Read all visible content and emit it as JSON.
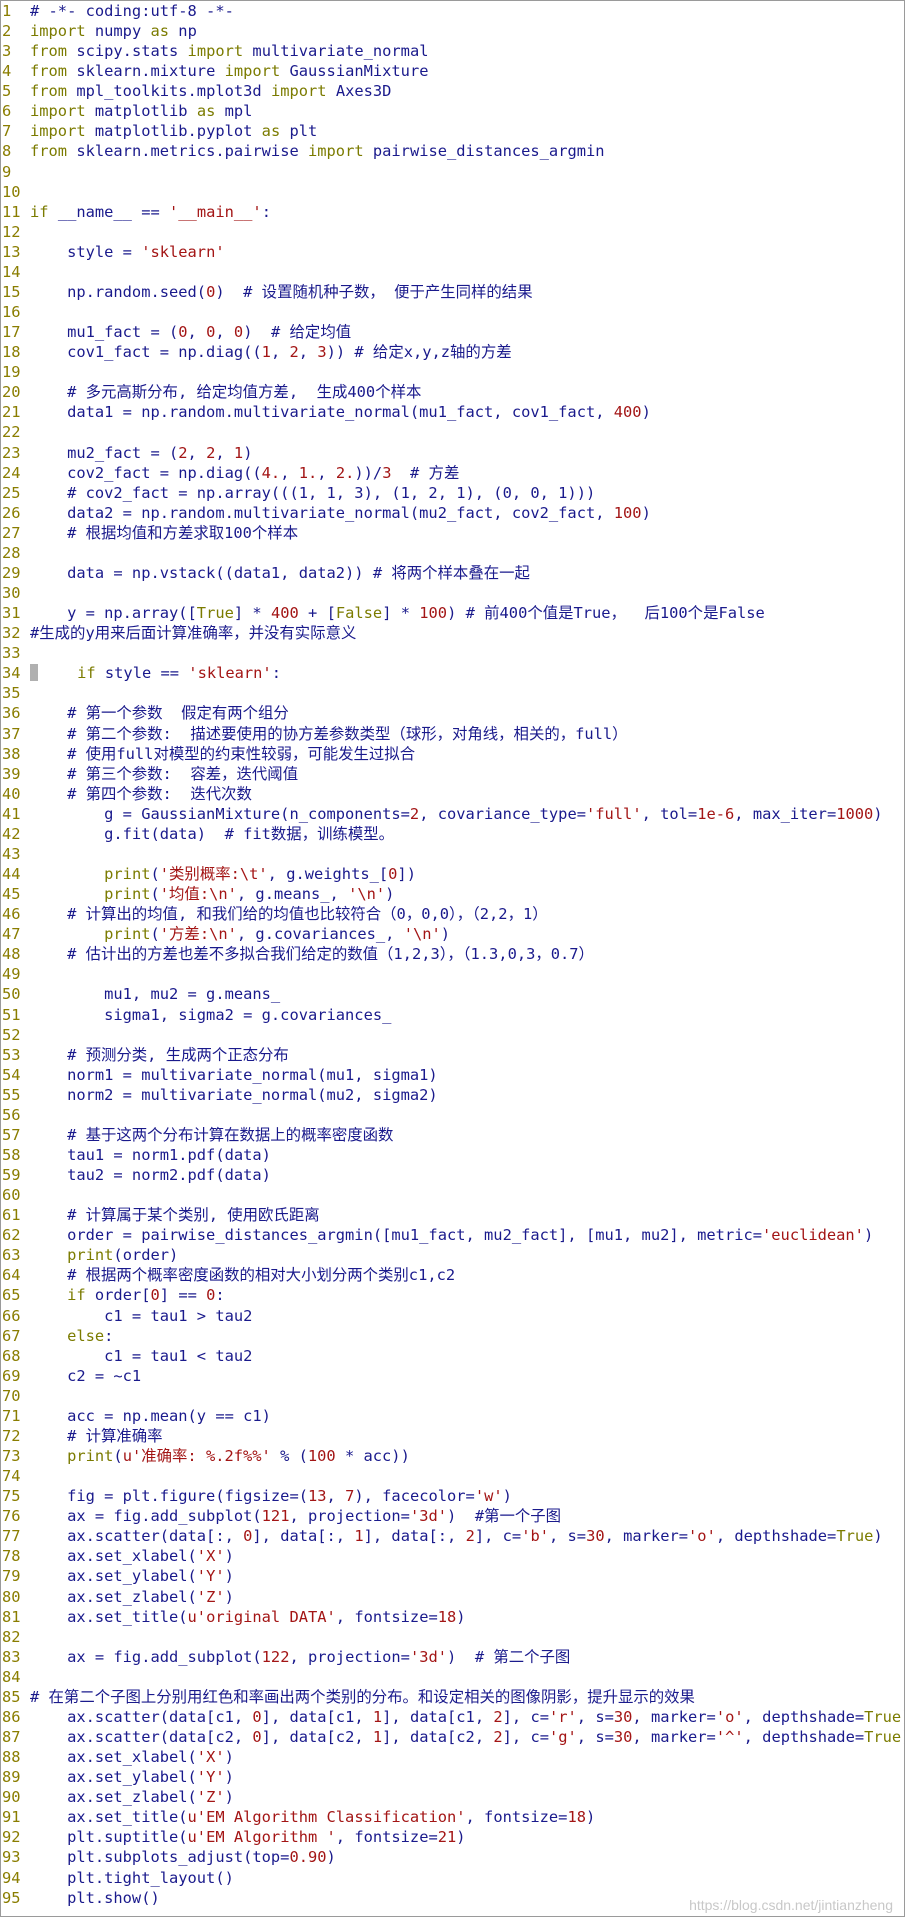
{
  "colors": {
    "keyword": "#7b7b00",
    "string": "#a31515",
    "text": "#1a1a8c",
    "line_number": "#8a7d00"
  },
  "watermark": "https://blog.csdn.net/jintianzheng",
  "lines": [
    [
      [
        "c",
        "# -*- coding:utf-8 -*-"
      ]
    ],
    [
      [
        "kw",
        "import"
      ],
      [
        "t",
        " numpy "
      ],
      [
        "kw",
        "as"
      ],
      [
        "t",
        " np"
      ]
    ],
    [
      [
        "kw",
        "from"
      ],
      [
        "t",
        " scipy.stats "
      ],
      [
        "kw",
        "import"
      ],
      [
        "t",
        " multivariate_normal"
      ]
    ],
    [
      [
        "kw",
        "from"
      ],
      [
        "t",
        " sklearn.mixture "
      ],
      [
        "kw",
        "import"
      ],
      [
        "t",
        " GaussianMixture"
      ]
    ],
    [
      [
        "kw",
        "from"
      ],
      [
        "t",
        " mpl_toolkits.mplot3d "
      ],
      [
        "kw",
        "import"
      ],
      [
        "t",
        " Axes3D"
      ]
    ],
    [
      [
        "kw",
        "import"
      ],
      [
        "t",
        " matplotlib "
      ],
      [
        "kw",
        "as"
      ],
      [
        "t",
        " mpl"
      ]
    ],
    [
      [
        "kw",
        "import"
      ],
      [
        "t",
        " matplotlib.pyplot "
      ],
      [
        "kw",
        "as"
      ],
      [
        "t",
        " plt"
      ]
    ],
    [
      [
        "kw",
        "from"
      ],
      [
        "t",
        " sklearn.metrics.pairwise "
      ],
      [
        "kw",
        "import"
      ],
      [
        "t",
        " pairwise_distances_argmin"
      ]
    ],
    [],
    [],
    [
      [
        "kw",
        "if"
      ],
      [
        "t",
        " __name__ == "
      ],
      [
        "s",
        "'__main__'"
      ],
      [
        "t",
        ":"
      ]
    ],
    [],
    [
      [
        "t",
        "    style = "
      ],
      [
        "s",
        "'sklearn'"
      ]
    ],
    [],
    [
      [
        "t",
        "    np.random.seed("
      ],
      [
        "n",
        "0"
      ],
      [
        "t",
        ")  # 设置随机种子数， 便于产生同样的结果"
      ]
    ],
    [],
    [
      [
        "t",
        "    mu1_fact = ("
      ],
      [
        "n",
        "0"
      ],
      [
        "t",
        ", "
      ],
      [
        "n",
        "0"
      ],
      [
        "t",
        ", "
      ],
      [
        "n",
        "0"
      ],
      [
        "t",
        ")  # 给定均值"
      ]
    ],
    [
      [
        "t",
        "    cov1_fact = np.diag(("
      ],
      [
        "n",
        "1"
      ],
      [
        "t",
        ", "
      ],
      [
        "n",
        "2"
      ],
      [
        "t",
        ", "
      ],
      [
        "n",
        "3"
      ],
      [
        "t",
        ")) # 给定x,y,z轴的方差"
      ]
    ],
    [],
    [
      [
        "t",
        "    # 多元高斯分布, 给定均值方差,  生成400个样本"
      ]
    ],
    [
      [
        "t",
        "    data1 = np.random.multivariate_normal(mu1_fact, cov1_fact, "
      ],
      [
        "n",
        "400"
      ],
      [
        "t",
        ")"
      ]
    ],
    [],
    [
      [
        "t",
        "    mu2_fact = ("
      ],
      [
        "n",
        "2"
      ],
      [
        "t",
        ", "
      ],
      [
        "n",
        "2"
      ],
      [
        "t",
        ", "
      ],
      [
        "n",
        "1"
      ],
      [
        "t",
        ")"
      ]
    ],
    [
      [
        "t",
        "    cov2_fact = np.diag(("
      ],
      [
        "n",
        "4."
      ],
      [
        "t",
        ", "
      ],
      [
        "n",
        "1."
      ],
      [
        "t",
        ", "
      ],
      [
        "n",
        "2."
      ],
      [
        "t",
        "))/"
      ],
      [
        "n",
        "3"
      ],
      [
        "t",
        "  # 方差"
      ]
    ],
    [
      [
        "t",
        "    # cov2_fact = np.array(((1, 1, 3), (1, 2, 1), (0, 0, 1)))"
      ]
    ],
    [
      [
        "t",
        "    data2 = np.random.multivariate_normal(mu2_fact, cov2_fact, "
      ],
      [
        "n",
        "100"
      ],
      [
        "t",
        ")"
      ]
    ],
    [
      [
        "t",
        "    # 根据均值和方差求取100个样本"
      ]
    ],
    [],
    [
      [
        "t",
        "    data = np.vstack((data1, data2)) # 将两个样本叠在一起"
      ]
    ],
    [],
    [
      [
        "t",
        "    y = np.array(["
      ],
      [
        "kw",
        "True"
      ],
      [
        "t",
        "] * "
      ],
      [
        "n",
        "400"
      ],
      [
        "t",
        " + ["
      ],
      [
        "kw",
        "False"
      ],
      [
        "t",
        "] * "
      ],
      [
        "n",
        "100"
      ],
      [
        "t",
        ") # 前400个值是True，  后100个是False"
      ]
    ],
    [
      [
        "t",
        "#生成的y用来后面计算准确率，并没有实际意义"
      ]
    ],
    [],
    [
      [
        "cur",
        ""
      ],
      [
        "t",
        "    "
      ],
      [
        "kw",
        "if"
      ],
      [
        "t",
        " style == "
      ],
      [
        "s",
        "'sklearn'"
      ],
      [
        "t",
        ":"
      ]
    ],
    [],
    [
      [
        "t",
        "    # 第一个参数  假定有两个组分"
      ]
    ],
    [
      [
        "t",
        "    # 第二个参数:  描述要使用的协方差参数类型（球形，对角线，相关的，full）"
      ]
    ],
    [
      [
        "t",
        "    # 使用full对模型的约束性较弱，可能发生过拟合"
      ]
    ],
    [
      [
        "t",
        "    # 第三个参数:  容差，迭代阈值"
      ]
    ],
    [
      [
        "t",
        "    # 第四个参数:  迭代次数"
      ]
    ],
    [
      [
        "t",
        "        g = GaussianMixture(n_components="
      ],
      [
        "n",
        "2"
      ],
      [
        "t",
        ", covariance_type="
      ],
      [
        "s",
        "'full'"
      ],
      [
        "t",
        ", tol="
      ],
      [
        "n",
        "1e-6"
      ],
      [
        "t",
        ", max_iter="
      ],
      [
        "n",
        "1000"
      ],
      [
        "t",
        ")"
      ]
    ],
    [
      [
        "t",
        "        g.fit(data)  # fit数据，训练模型。"
      ]
    ],
    [],
    [
      [
        "t",
        "        "
      ],
      [
        "kw",
        "print"
      ],
      [
        "t",
        "("
      ],
      [
        "s",
        "'类别概率:\\t'"
      ],
      [
        "t",
        ", g.weights_["
      ],
      [
        "n",
        "0"
      ],
      [
        "t",
        "])"
      ]
    ],
    [
      [
        "t",
        "        "
      ],
      [
        "kw",
        "print"
      ],
      [
        "t",
        "("
      ],
      [
        "s",
        "'均值:\\n'"
      ],
      [
        "t",
        ", g.means_, "
      ],
      [
        "s",
        "'\\n'"
      ],
      [
        "t",
        ")"
      ]
    ],
    [
      [
        "t",
        "    # 计算出的均值, 和我们给的均值也比较符合（0，0,0），（2,2，1）"
      ]
    ],
    [
      [
        "t",
        "        "
      ],
      [
        "kw",
        "print"
      ],
      [
        "t",
        "("
      ],
      [
        "s",
        "'方差:\\n'"
      ],
      [
        "t",
        ", g.covariances_, "
      ],
      [
        "s",
        "'\\n'"
      ],
      [
        "t",
        ")"
      ]
    ],
    [
      [
        "t",
        "    # 估计出的方差也差不多拟合我们给定的数值（1,2,3），（1.3,0,3，0.7）"
      ]
    ],
    [],
    [
      [
        "t",
        "        mu1, mu2 = g.means_"
      ]
    ],
    [
      [
        "t",
        "        sigma1, sigma2 = g.covariances_"
      ]
    ],
    [],
    [
      [
        "t",
        "    # 预测分类, 生成两个正态分布"
      ]
    ],
    [
      [
        "t",
        "    norm1 = multivariate_normal(mu1, sigma1)"
      ]
    ],
    [
      [
        "t",
        "    norm2 = multivariate_normal(mu2, sigma2)"
      ]
    ],
    [],
    [
      [
        "t",
        "    # 基于这两个分布计算在数据上的概率密度函数"
      ]
    ],
    [
      [
        "t",
        "    tau1 = norm1.pdf(data)"
      ]
    ],
    [
      [
        "t",
        "    tau2 = norm2.pdf(data)"
      ]
    ],
    [],
    [
      [
        "t",
        "    # 计算属于某个类别, 使用欧氏距离"
      ]
    ],
    [
      [
        "t",
        "    order = pairwise_distances_argmin([mu1_fact, mu2_fact], [mu1, mu2], metric="
      ],
      [
        "s",
        "'euclidean'"
      ],
      [
        "t",
        ")"
      ]
    ],
    [
      [
        "t",
        "    "
      ],
      [
        "kw",
        "print"
      ],
      [
        "t",
        "(order)"
      ]
    ],
    [
      [
        "t",
        "    # 根据两个概率密度函数的相对大小划分两个类别c1,c2"
      ]
    ],
    [
      [
        "t",
        "    "
      ],
      [
        "kw",
        "if"
      ],
      [
        "t",
        " order["
      ],
      [
        "n",
        "0"
      ],
      [
        "t",
        "] == "
      ],
      [
        "n",
        "0"
      ],
      [
        "t",
        ":"
      ]
    ],
    [
      [
        "t",
        "        c1 = tau1 > tau2"
      ]
    ],
    [
      [
        "t",
        "    "
      ],
      [
        "kw",
        "else"
      ],
      [
        "t",
        ":"
      ]
    ],
    [
      [
        "t",
        "        c1 = tau1 < tau2"
      ]
    ],
    [
      [
        "t",
        "    c2 = ~c1"
      ]
    ],
    [],
    [
      [
        "t",
        "    acc = np.mean(y == c1)"
      ]
    ],
    [
      [
        "t",
        "    # 计算准确率"
      ]
    ],
    [
      [
        "t",
        "    "
      ],
      [
        "kw",
        "print"
      ],
      [
        "t",
        "("
      ],
      [
        "s",
        "u'准确率: %.2f%%'"
      ],
      [
        "t",
        " % ("
      ],
      [
        "n",
        "100"
      ],
      [
        "t",
        " * acc))"
      ]
    ],
    [],
    [
      [
        "t",
        "    fig = plt.figure(figsize=("
      ],
      [
        "n",
        "13"
      ],
      [
        "t",
        ", "
      ],
      [
        "n",
        "7"
      ],
      [
        "t",
        "), facecolor="
      ],
      [
        "s",
        "'w'"
      ],
      [
        "t",
        ")"
      ]
    ],
    [
      [
        "t",
        "    ax = fig.add_subplot("
      ],
      [
        "n",
        "121"
      ],
      [
        "t",
        ", projection="
      ],
      [
        "s",
        "'3d'"
      ],
      [
        "t",
        ")  #第一个子图"
      ]
    ],
    [
      [
        "t",
        "    ax.scatter(data[:, "
      ],
      [
        "n",
        "0"
      ],
      [
        "t",
        "], data[:, "
      ],
      [
        "n",
        "1"
      ],
      [
        "t",
        "], data[:, "
      ],
      [
        "n",
        "2"
      ],
      [
        "t",
        "], c="
      ],
      [
        "s",
        "'b'"
      ],
      [
        "t",
        ", s="
      ],
      [
        "n",
        "30"
      ],
      [
        "t",
        ", marker="
      ],
      [
        "s",
        "'o'"
      ],
      [
        "t",
        ", depthshade="
      ],
      [
        "kw",
        "True"
      ],
      [
        "t",
        ")"
      ]
    ],
    [
      [
        "t",
        "    ax.set_xlabel("
      ],
      [
        "s",
        "'X'"
      ],
      [
        "t",
        ")"
      ]
    ],
    [
      [
        "t",
        "    ax.set_ylabel("
      ],
      [
        "s",
        "'Y'"
      ],
      [
        "t",
        ")"
      ]
    ],
    [
      [
        "t",
        "    ax.set_zlabel("
      ],
      [
        "s",
        "'Z'"
      ],
      [
        "t",
        ")"
      ]
    ],
    [
      [
        "t",
        "    ax.set_title("
      ],
      [
        "s",
        "u'original DATA'"
      ],
      [
        "t",
        ", fontsize="
      ],
      [
        "n",
        "18"
      ],
      [
        "t",
        ")"
      ]
    ],
    [],
    [
      [
        "t",
        "    ax = fig.add_subplot("
      ],
      [
        "n",
        "122"
      ],
      [
        "t",
        ", projection="
      ],
      [
        "s",
        "'3d'"
      ],
      [
        "t",
        ")  # 第二个子图"
      ]
    ],
    [],
    [
      [
        "t",
        "# 在第二个子图上分别用红色和率画出两个类别的分布。和设定相关的图像阴影，提升显示的效果"
      ]
    ],
    [
      [
        "t",
        "    ax.scatter(data[c1, "
      ],
      [
        "n",
        "0"
      ],
      [
        "t",
        "], data[c1, "
      ],
      [
        "n",
        "1"
      ],
      [
        "t",
        "], data[c1, "
      ],
      [
        "n",
        "2"
      ],
      [
        "t",
        "], c="
      ],
      [
        "s",
        "'r'"
      ],
      [
        "t",
        ", s="
      ],
      [
        "n",
        "30"
      ],
      [
        "t",
        ", marker="
      ],
      [
        "s",
        "'o'"
      ],
      [
        "t",
        ", depthshade="
      ],
      [
        "kw",
        "True"
      ],
      [
        "t",
        ")"
      ]
    ],
    [
      [
        "t",
        "    ax.scatter(data[c2, "
      ],
      [
        "n",
        "0"
      ],
      [
        "t",
        "], data[c2, "
      ],
      [
        "n",
        "1"
      ],
      [
        "t",
        "], data[c2, "
      ],
      [
        "n",
        "2"
      ],
      [
        "t",
        "], c="
      ],
      [
        "s",
        "'g'"
      ],
      [
        "t",
        ", s="
      ],
      [
        "n",
        "30"
      ],
      [
        "t",
        ", marker="
      ],
      [
        "s",
        "'^'"
      ],
      [
        "t",
        ", depthshade="
      ],
      [
        "kw",
        "True"
      ],
      [
        "t",
        ")"
      ]
    ],
    [
      [
        "t",
        "    ax.set_xlabel("
      ],
      [
        "s",
        "'X'"
      ],
      [
        "t",
        ")"
      ]
    ],
    [
      [
        "t",
        "    ax.set_ylabel("
      ],
      [
        "s",
        "'Y'"
      ],
      [
        "t",
        ")"
      ]
    ],
    [
      [
        "t",
        "    ax.set_zlabel("
      ],
      [
        "s",
        "'Z'"
      ],
      [
        "t",
        ")"
      ]
    ],
    [
      [
        "t",
        "    ax.set_title("
      ],
      [
        "s",
        "u'EM Algorithm Classification'"
      ],
      [
        "t",
        ", fontsize="
      ],
      [
        "n",
        "18"
      ],
      [
        "t",
        ")"
      ]
    ],
    [
      [
        "t",
        "    plt.suptitle("
      ],
      [
        "s",
        "u'EM Algorithm '"
      ],
      [
        "t",
        ", fontsize="
      ],
      [
        "n",
        "21"
      ],
      [
        "t",
        ")"
      ]
    ],
    [
      [
        "t",
        "    plt.subplots_adjust(top="
      ],
      [
        "n",
        "0.90"
      ],
      [
        "t",
        ")"
      ]
    ],
    [
      [
        "t",
        "    plt.tight_layout()"
      ]
    ],
    [
      [
        "t",
        "    plt.show()"
      ]
    ]
  ]
}
